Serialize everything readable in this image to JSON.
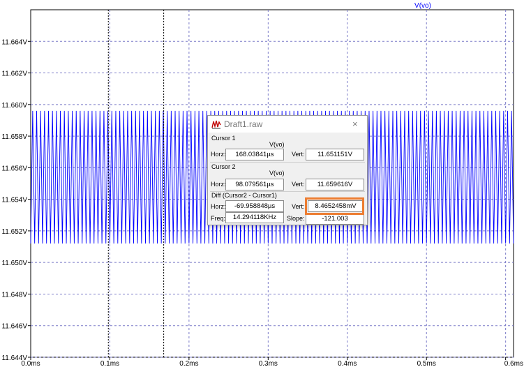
{
  "plot": {
    "trace_label": "V(vo)",
    "trace_color": "#0000ff",
    "grid_color": "#7b7bc8",
    "y_tick_labels": [
      "11.644V",
      "11.646V",
      "11.648V",
      "11.650V",
      "11.652V",
      "11.654V",
      "11.656V",
      "11.658V",
      "11.660V",
      "11.662V",
      "11.664V"
    ],
    "x_tick_labels": [
      "0.0ms",
      "0.1ms",
      "0.2ms",
      "0.3ms",
      "0.4ms",
      "0.5ms",
      "0.6ms"
    ],
    "y_range_V": [
      11.644,
      11.666
    ],
    "x_range_ms": [
      0.0,
      0.61
    ],
    "waveform": {
      "type": "triangle",
      "min_V": 11.6512,
      "max_V": 11.6596,
      "frequency_kHz": 200
    },
    "cursor_lines_ms": [
      0.098079561,
      0.16803841
    ]
  },
  "dialog": {
    "title": "Draft1.raw",
    "close_glyph": "×",
    "cursor1": {
      "heading": "Cursor 1",
      "trace": "V(vo)",
      "horz_label": "Horz:",
      "horz_value": "168.03841µs",
      "vert_label": "Vert:",
      "vert_value": "11.651151V"
    },
    "cursor2": {
      "heading": "Cursor 2",
      "trace": "V(vo)",
      "horz_label": "Horz:",
      "horz_value": "98.079561µs",
      "vert_label": "Vert:",
      "vert_value": "11.659616V"
    },
    "diff": {
      "heading": "Diff (Cursor2 - Cursor1)",
      "horz_label": "Horz:",
      "horz_value": "-69.958848µs",
      "vert_label": "Vert:",
      "vert_value": "8.4652458mV",
      "freq_label": "Freq:",
      "freq_value": "14.294118KHz",
      "slope_label": "Slope:",
      "slope_value": "-121.003"
    },
    "highlight_color": "#ed7d31"
  }
}
